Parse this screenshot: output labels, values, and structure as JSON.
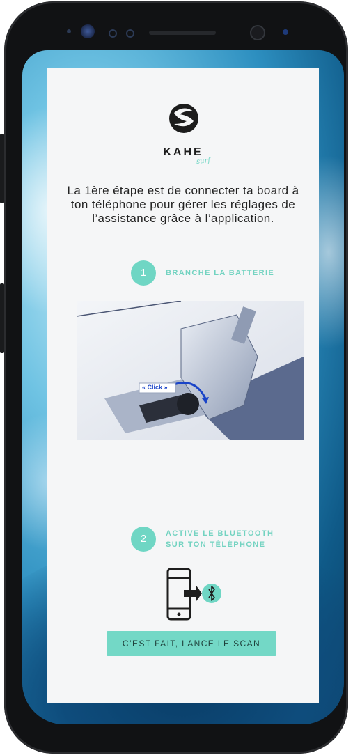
{
  "brand": {
    "name": "KAHE",
    "tagline": "surf"
  },
  "intro": {
    "text": "La 1ère étape est de connecter ta board à ton téléphone pour gérer les réglages de l’assistance grâce à l’application."
  },
  "steps": [
    {
      "number": "1",
      "label_line1": "BRANCHE LA BATTERIE",
      "label_line2": ""
    },
    {
      "number": "2",
      "label_line1": "ACTIVE LE BLUETOOTH",
      "label_line2": "SUR TON TÉLÉPHONE"
    }
  ],
  "battery_photo": {
    "callout": "« Click »"
  },
  "bluetooth_icon": {
    "icon": "bluetooth-icon"
  },
  "cta": {
    "label": "C’EST FAIT, LANCE LE SCAN"
  },
  "colors": {
    "accent": "#73d8c6",
    "card_bg": "#f5f6f7",
    "text": "#232323",
    "ocean": "#2d8fc0"
  }
}
